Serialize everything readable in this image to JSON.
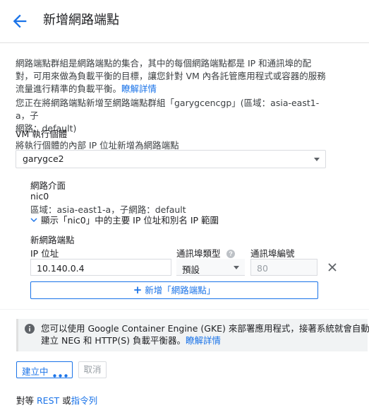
{
  "header": {
    "title": "新增網路端點",
    "back_icon": "arrow-back-icon"
  },
  "intro": {
    "text": "網路端點群組是網路端點的集合，其中的每個網路端點都是 IP 和通訊埠的配對，可用來做為負載平衡的目標，讓您針對 VM 內各託管應用程式或容器的服務流量進行精準的負載平衡。",
    "link": "瞭解詳情"
  },
  "target_group": {
    "prefix": "您正在將網路端點新增至網路端點群組「garygcencgp」(區域：asia-east1-a，子",
    "suffix": "網路：default)"
  },
  "vm_instance": {
    "label": "VM 執行個體",
    "hint": "將執行個體的內部 IP 位址新增為網路端點",
    "selected": "garygce2"
  },
  "network_interface": {
    "label": "網路介面",
    "name": "nic0",
    "details": "區域：asia-east1-a，子網路：default",
    "expand_link": "顯示「nic0」中的主要 IP 位址和別名 IP 範圍"
  },
  "new_endpoint": {
    "label": "新網路端點",
    "col_ip": "IP 位址",
    "col_port_type": "通訊埠類型",
    "col_port_number": "通訊埠編號",
    "ip_value": "10.140.0.4",
    "port_type_value": "預設",
    "port_number_value": "80",
    "add_button": "新增「網路端點」"
  },
  "info": {
    "text1": "您可以使用 Google Container Engine (GKE) 來部署應用程式，接著系統就會自動",
    "text2": "建立 NEG 和 HTTP(S) 負載平衡器。",
    "link": "瞭解詳情"
  },
  "actions": {
    "create": "建立中",
    "cancel": "取消"
  },
  "footer": {
    "prefix": "對等 ",
    "rest": "REST",
    "or": " 或",
    "cli": "指令列"
  },
  "colors": {
    "accent": "#1a73e8",
    "text": "#202124",
    "muted": "#80868b",
    "info_bg": "#f1f3f4"
  }
}
